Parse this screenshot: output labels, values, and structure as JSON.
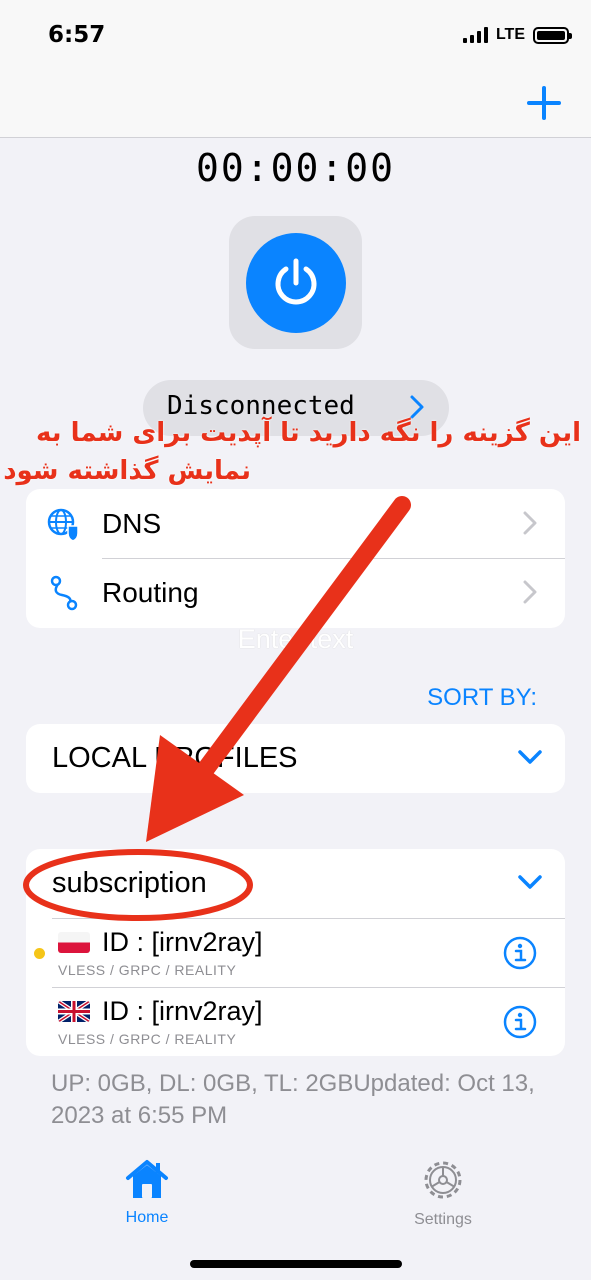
{
  "status_bar": {
    "time": "6:57",
    "network": "LTE"
  },
  "timer": "00:00:00",
  "connection": {
    "status": "Disconnected"
  },
  "overlay_note": {
    "line1": "این گزینه را نگه دارید تا آپدیت برای شما به",
    "line2": "نمایش گذاشته شود"
  },
  "settings_rows": [
    {
      "label": "DNS",
      "icon": "globe-shield-icon"
    },
    {
      "label": "Routing",
      "icon": "routing-icon"
    }
  ],
  "overlay_placeholder": "Enter text",
  "sort_by": "SORT BY:",
  "local_profiles": {
    "title": "LOCAL PROFILES"
  },
  "subscription": {
    "title": "subscription",
    "servers": [
      {
        "flag": "poland-flag-icon",
        "name": "ID : [irnv2ray]",
        "protocol": "VLESS / GRPC / REALITY",
        "active": true
      },
      {
        "flag": "uk-flag-icon",
        "name": "ID : [irnv2ray]",
        "protocol": "VLESS / GRPC / REALITY",
        "active": false
      }
    ],
    "usage": "UP: 0GB, DL: 0GB, TL: 2GBUpdated: Oct 13, 2023 at 6:55 PM"
  },
  "tabs": [
    {
      "label": "Home",
      "icon": "house-icon",
      "active": true
    },
    {
      "label": "Settings",
      "icon": "gear-icon",
      "active": false
    }
  ],
  "colors": {
    "accent": "#0a84ff",
    "annotation": "#e8311a",
    "inactive": "#8e8e93",
    "active_dot": "#f5c518"
  }
}
